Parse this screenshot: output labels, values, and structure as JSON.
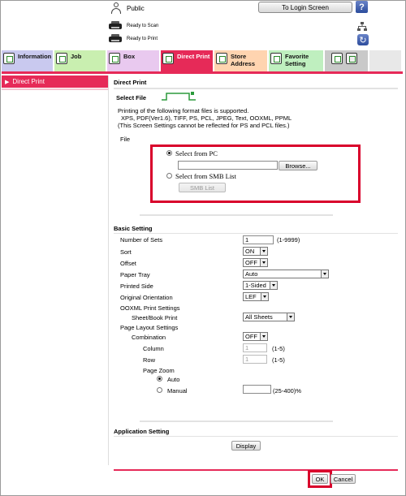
{
  "header": {
    "user_label": "Public",
    "login_button": "To Login Screen",
    "help_glyph": "?",
    "scan_status": "Ready to Scan",
    "print_status": "Ready to Print"
  },
  "tabs": [
    {
      "label": "Information",
      "icon": "information-icon"
    },
    {
      "label": "Job",
      "icon": "job-icon"
    },
    {
      "label": "Box",
      "icon": "box-icon"
    },
    {
      "label": "Direct Print",
      "icon": "direct-print-icon",
      "active": true
    },
    {
      "label": "Store Address",
      "icon": "store-address-icon"
    },
    {
      "label": "Favorite Setting",
      "icon": "favorite-setting-icon"
    },
    {
      "label": "",
      "icon": "customize-icon"
    }
  ],
  "sidebar": {
    "items": [
      {
        "label": "Direct Print",
        "active": true
      }
    ]
  },
  "main": {
    "page_title": "Direct Print",
    "select_file": {
      "heading": "Select File",
      "desc_line1": "Printing of the following format files is supported.",
      "desc_line2": "XPS, PDF(Ver1.6), TIFF, PS, PCL, JPEG, Text, OOXML, PPML",
      "desc_line3": "(This Screen Settings cannot be reflected for PS and PCL files.)",
      "file_label": "File",
      "from_pc": "Select from PC",
      "browse": "Browse...",
      "from_smb": "Select from SMB List",
      "smb_list": "SMB List"
    },
    "basic": {
      "heading": "Basic Setting",
      "number_of_sets": "Number of Sets",
      "number_of_sets_value": "1",
      "number_of_sets_range": "(1-9999)",
      "sort": "Sort",
      "sort_value": "ON",
      "offset": "Offset",
      "offset_value": "OFF",
      "paper_tray": "Paper Tray",
      "paper_tray_value": "Auto",
      "printed_side": "Printed Side",
      "printed_side_value": "1-Sided",
      "original_orientation": "Original Orientation",
      "original_orientation_value": "LEF",
      "ooxml": "OOXML Print Settings",
      "sheet_book": "Sheet/Book Print",
      "sheet_book_value": "All Sheets",
      "page_layout": "Page Layout Settings",
      "combination": "Combination",
      "combination_value": "OFF",
      "column": "Column",
      "column_value": "1",
      "column_range": "(1-5)",
      "row": "Row",
      "row_value": "1",
      "row_range": "(1-5)",
      "page_zoom": "Page Zoom",
      "zoom_auto": "Auto",
      "zoom_manual": "Manual",
      "zoom_range": "(25-400)%"
    },
    "application": {
      "heading": "Application Setting",
      "display_button": "Display"
    },
    "footer": {
      "ok": "OK",
      "cancel": "Cancel"
    }
  },
  "colors": {
    "accent": "#e62a58",
    "highlight_box": "#d9002b"
  }
}
